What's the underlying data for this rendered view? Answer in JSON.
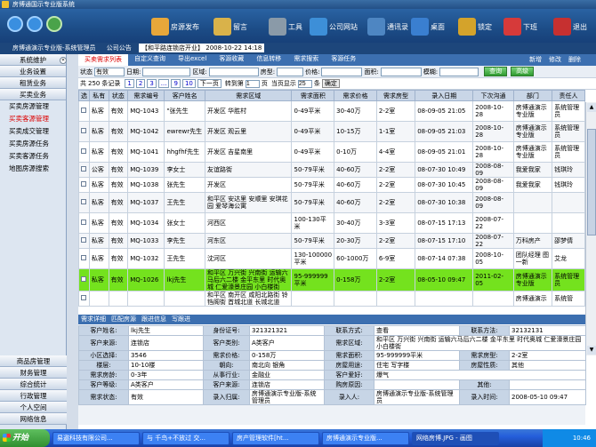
{
  "window": {
    "title": "房博通国示专业版系统"
  },
  "toolbar": [
    {
      "label": "房源发布",
      "icon": "house-icon",
      "color": "#e7a73a"
    },
    {
      "label": "留言",
      "icon": "envelope-icon",
      "color": "#d9b24a"
    },
    {
      "label": "工具",
      "icon": "wrench-icon",
      "color": "#8a9aa8"
    },
    {
      "label": "公司网站",
      "icon": "globe-icon",
      "color": "#3d8fd8"
    },
    {
      "label": "通讯录",
      "icon": "address-book-icon",
      "color": "#4e86c2"
    },
    {
      "label": "桌面",
      "icon": "monitor-icon",
      "color": "#3a7fd0"
    },
    {
      "label": "锁定",
      "icon": "lock-icon",
      "color": "#d4a32b"
    },
    {
      "label": "下班",
      "icon": "exit-icon",
      "color": "#d63a3a"
    },
    {
      "label": "退出",
      "icon": "power-icon",
      "color": "#c63030"
    }
  ],
  "subbar": {
    "user": "房博通演示专业版-系统管理员",
    "notice_label": "公司公告",
    "notice": "【和平路连锁店开业】",
    "date": "2008-10-22 14:18"
  },
  "sidebar": {
    "top_groups": [
      "系统维护",
      "业务设置",
      "租赁业务",
      "买卖业务"
    ],
    "items": [
      "买卖房源管理",
      "买卖客源管理",
      "买卖成交管理",
      "买卖房源任务",
      "买卖客源任务",
      "地图房源搜索"
    ],
    "active_item": "买卖客源管理",
    "bottom_groups": [
      "商品房管理",
      "财务管理",
      "综合统计",
      "行政管理",
      "个人空间",
      "网络信息"
    ]
  },
  "tabs": {
    "items": [
      "买卖需求列表",
      "自定义查询",
      "导出excel",
      "客源收藏",
      "信息转移",
      "需求搜索",
      "客源任务"
    ],
    "active": "买卖需求列表",
    "right": [
      "新增",
      "修改",
      "删除"
    ]
  },
  "filter": {
    "status_label": "状态",
    "status": "有效",
    "date_label": "日期:",
    "area_label": "区域:",
    "room_label": "房型:",
    "price_label": "价格:",
    "size_label": "面积:",
    "fuzzy_label": "模糊:",
    "search_btn": "查询",
    "advanced_btn": "高级"
  },
  "pager": {
    "total_prefix": "共",
    "total": "250",
    "total_suffix": "条记录",
    "pages": [
      "1",
      "2",
      "3",
      "...",
      "9",
      "10"
    ],
    "next": "下一页",
    "goto_label": "转到第",
    "page": "1",
    "page_unit": "页",
    "per_page_label": "当页显示",
    "per_page": "25",
    "per_page_unit": "条",
    "confirm": "确定"
  },
  "table": {
    "columns": [
      "选",
      "私有",
      "状态",
      "需求编号",
      "客户姓名",
      "需求区域",
      "需求面积",
      "需求价格",
      "需求房型",
      "录入日期",
      "下次沟通",
      "部门",
      "责任人"
    ],
    "rows": [
      {
        "type": "私客",
        "status": "有效",
        "id": "MQ-1043",
        "name": "\"张先生",
        "region": "开发区 华胜村",
        "size": "0-49平米",
        "price": "30-40万",
        "room": "2-2室",
        "date": "08-09-05 21:05",
        "next": "2008-10-28",
        "dept": "房博通演示专业版",
        "owner": "系统管理员",
        "tall": true
      },
      {
        "type": "私客",
        "status": "有效",
        "id": "MQ-1042",
        "name": "ewrewr先生",
        "region": "开发区 观云里",
        "size": "0-49平米",
        "price": "10-15万",
        "room": "1-1室",
        "date": "08-09-05 21:03",
        "next": "2008-10-28",
        "dept": "房博通演示专业版",
        "owner": "系统管理员",
        "tall": true
      },
      {
        "type": "私客",
        "status": "有效",
        "id": "MQ-1041",
        "name": "hhgfhf先生",
        "region": "开发区 吉星南里",
        "size": "0-49平米",
        "price": "0-10万",
        "room": "4-4室",
        "date": "08-09-05 21:01",
        "next": "2008-10-28",
        "dept": "房博通演示专业版",
        "owner": "系统管理员",
        "tall": true
      },
      {
        "type": "公客",
        "status": "有效",
        "id": "MQ-1039",
        "name": "李女士",
        "region": "友谊路街",
        "size": "50-79平米",
        "price": "40-60万",
        "room": "2-2室",
        "date": "08-07-30 10:49",
        "next": "2008-08-09",
        "dept": "我爱我家",
        "owner": "钱琪玲",
        "tall": false
      },
      {
        "type": "私客",
        "status": "有效",
        "id": "MQ-1038",
        "name": "张先生",
        "region": "开发区",
        "size": "50-79平米",
        "price": "40-60万",
        "room": "2-2室",
        "date": "08-07-30 10:45",
        "next": "2008-08-09",
        "dept": "我爱我家",
        "owner": "钱琪玲",
        "tall": false
      },
      {
        "type": "私客",
        "status": "有效",
        "id": "MQ-1037",
        "name": "王先生",
        "region": "和平区 安达里 安顺里 安琪花园 爱琴海公寓",
        "size": "50-79平米",
        "price": "40-60万",
        "room": "2-2室",
        "date": "08-07-30 10:38",
        "next": "2008-08-09",
        "dept": "",
        "owner": "",
        "tall": true
      },
      {
        "type": "私客",
        "status": "有效",
        "id": "MQ-1034",
        "name": "张女士",
        "region": "河西区",
        "size": "100-130平米",
        "price": "30-40万",
        "room": "3-3室",
        "date": "08-07-15 17:13",
        "next": "2008-07-22",
        "dept": "",
        "owner": "",
        "tall": true
      },
      {
        "type": "私客",
        "status": "有效",
        "id": "MQ-1033",
        "name": "李先生",
        "region": "河东区",
        "size": "50-79平米",
        "price": "20-30万",
        "room": "2-2室",
        "date": "08-07-15 17:10",
        "next": "2008-07-22",
        "dept": "万科房产",
        "owner": "邵梦倩",
        "tall": false
      },
      {
        "type": "私客",
        "status": "有效",
        "id": "MQ-1032",
        "name": "王先生",
        "region": "沈河区",
        "size": "130-100000平米",
        "price": "60-1000万",
        "room": "6-9室",
        "date": "08-07-14 07:38",
        "next": "2008-10-05",
        "dept": "团队经理 图一新",
        "owner": "艾龙",
        "tall": true
      },
      {
        "type": "私客",
        "status": "有效",
        "id": "MQ-1026",
        "name": "lkj先生",
        "region": "和平区 万兴街 兴南街 运输六马后六二楼 金平东里 时代奥城 仁爱濠景庄园 小白楼街",
        "size": "95-999999平米",
        "price": "0-158万",
        "room": "2-2室",
        "date": "08-05-10 09:47",
        "next": "2011-02-05",
        "dept": "房博通演示专业版",
        "owner": "系统管理员",
        "tall": true,
        "highlight": true
      },
      {
        "type": "",
        "status": "",
        "id": "",
        "name": "",
        "region": "和平区 南开区 咸阳北路街 铃铛阁街 首城北道 长城北道",
        "size": "",
        "price": "",
        "room": "",
        "date": "",
        "next": "",
        "dept": "房博通演示",
        "owner": "系统管",
        "tall": false
      }
    ]
  },
  "detail_tabs": [
    "需求详细",
    "匹配房源",
    "跟进信息",
    "写跟进"
  ],
  "detail": [
    [
      [
        "客户姓名:",
        "lkj先生"
      ],
      [
        "身份证号:",
        "321321321"
      ],
      [
        "联系方式:",
        "查看"
      ],
      [
        "联系方法:",
        "32132131"
      ]
    ],
    [
      [
        "客户来源:",
        "连锁店"
      ],
      [
        "客户类别:",
        "A类客户"
      ],
      [
        "需求区域:",
        "和平区 万兴街 兴南街 运输六马后六二楼 金平东里 时代奥城 仁爱濠景庄园 小白楼街"
      ]
    ],
    [
      [
        "小区选择:",
        "3546"
      ],
      [
        "需求价格:",
        "0-158万"
      ],
      [
        "需求面积:",
        "95-999999平米"
      ],
      [
        "需求房型:",
        "2-2室"
      ]
    ],
    [
      [
        "楼层:",
        "10-10楼"
      ],
      [
        "朝向:",
        "南北向 银角"
      ],
      [
        "房屋用途:",
        "住宅 写字楼"
      ],
      [
        "房屋性质:",
        "其他"
      ]
    ],
    [
      [
        "需求房龄:",
        "0-3年"
      ],
      [
        "从事行业:",
        "金融业"
      ],
      [
        "客户爱好:",
        "爆气"
      ]
    ],
    [
      [
        "客户等级:",
        "A类客户"
      ],
      [
        "客户来源:",
        "连锁店"
      ],
      [
        "购房原因:",
        ""
      ],
      [
        "其他:",
        ""
      ]
    ],
    [
      [
        "需求状态:",
        "有效"
      ],
      [
        "录入归属:",
        "房博通演示专业版-系统管理员"
      ],
      [
        "录入人:",
        "房博通演示专业版-系统管理员"
      ],
      [
        "录入时间:",
        "2008-05-10 09:47"
      ]
    ]
  ],
  "taskbar": {
    "start": "开始",
    "tasks": [
      "易遨科技有限公司...",
      "与 千鸟+不放过 交...",
      "房产管理软件[ht...",
      "房博通演示专业版...",
      "网络房博.JPG - 画图"
    ],
    "clock": "10:46"
  }
}
